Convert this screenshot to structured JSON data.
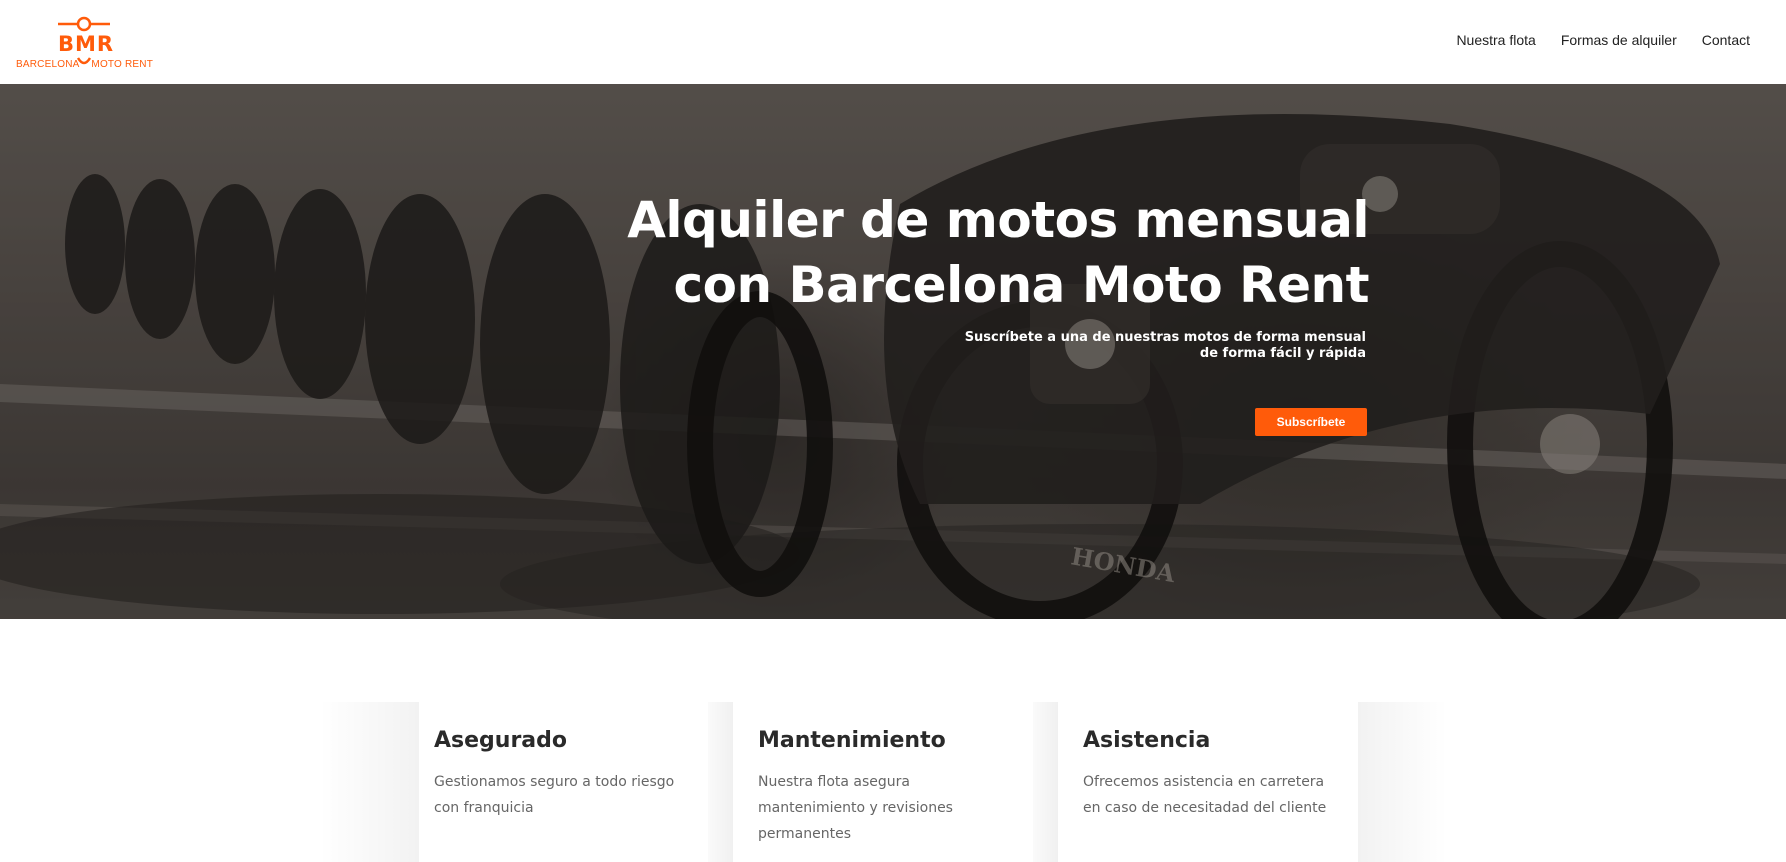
{
  "header": {
    "logo": {
      "mark": "BMR",
      "name_left": "BARCELONA",
      "name_right": "MOTO RENT",
      "brand_color": "#ff5b0a"
    },
    "nav": [
      {
        "label": "Nuestra flota"
      },
      {
        "label": "Formas de alquiler"
      },
      {
        "label": "Contact"
      }
    ]
  },
  "hero": {
    "title_line1": "Alquiler de motos mensual",
    "title_line2": "con Barcelona Moto Rent",
    "subtitle_line1": "Suscríbete a una de nuestras motos de forma mensual",
    "subtitle_line2": "de forma fácil y rápida",
    "cta_label": "Subscríbete",
    "background_icon": "motorcycle-row-photo"
  },
  "features": [
    {
      "title": "Asegurado",
      "text": "Gestionamos seguro a todo riesgo con franquicia"
    },
    {
      "title": "Mantenimiento",
      "text": "Nuestra flota asegura mantenimiento y revisiones permanentes"
    },
    {
      "title": "Asistencia",
      "text": "Ofrecemos asistencia en carretera en caso de necesitadad del cliente"
    }
  ]
}
